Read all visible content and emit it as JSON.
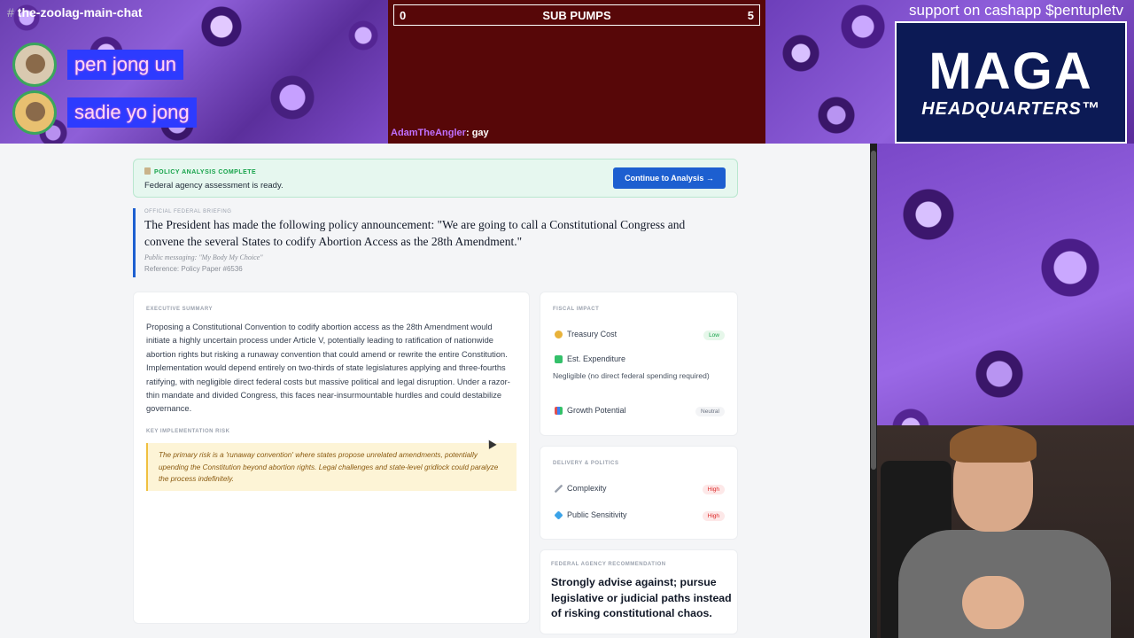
{
  "overlay": {
    "channel_hash": "#",
    "channel_name": "the-zoolag-main-chat",
    "members": [
      "pen jong un",
      "sadie yo jong"
    ],
    "pumps": {
      "left": "0",
      "title": "SUB PUMPS",
      "right": "5"
    },
    "chat": {
      "user": "AdamTheAngler",
      "sep": ": ",
      "message": "gay"
    },
    "support": "support on cashapp $pentupletv",
    "logo": {
      "big": "MAGA",
      "small": "HEADQUARTERS™"
    }
  },
  "banner": {
    "kicker": "POLICY ANALYSIS COMPLETE",
    "message": "Federal agency assessment is ready.",
    "cta": "Continue to Analysis →"
  },
  "briefing": {
    "kicker": "OFFICIAL FEDERAL BRIEFING",
    "title": "The President has made the following policy announcement: \"We are going to call a Constitutional Congress and convene the several States to codify Abortion Access as the 28th Amendment.\"",
    "messaging": "Public messaging: \"My Body My Choice\"",
    "reference": "Reference: Policy Paper #6536"
  },
  "executive": {
    "kicker": "EXECUTIVE SUMMARY",
    "summary": "Proposing a Constitutional Convention to codify abortion access as the 28th Amendment would initiate a highly uncertain process under Article V, potentially leading to ratification of nationwide abortion rights but risking a runaway convention that could amend or rewrite the entire Constitution. Implementation would depend entirely on two-thirds of state legislatures applying and three-fourths ratifying, with negligible direct federal costs but massive political and legal disruption. Under a razor-thin mandate and divided Congress, this faces near-insurmountable hurdles and could destabilize governance.",
    "risk_kicker": "KEY IMPLEMENTATION RISK",
    "risk": "The primary risk is a 'runaway convention' where states propose unrelated amendments, potentially upending the Constitution beyond abortion rights. Legal challenges and state-level gridlock could paralyze the process indefinitely."
  },
  "fiscal": {
    "kicker": "FISCAL IMPACT",
    "treasury_label": "Treasury Cost",
    "treasury_badge": "Low",
    "expenditure_label": "Est. Expenditure",
    "expenditure_value": "Negligible (no direct federal spending required)",
    "growth_label": "Growth Potential",
    "growth_badge": "Neutral"
  },
  "delivery": {
    "kicker": "DELIVERY & POLITICS",
    "complexity_label": "Complexity",
    "complexity_badge": "High",
    "sensitivity_label": "Public Sensitivity",
    "sensitivity_badge": "High"
  },
  "recommendation": {
    "kicker": "FEDERAL AGENCY RECOMMENDATION",
    "text": "Strongly advise against; pursue legislative or judicial paths instead of risking constitutional chaos."
  },
  "colors": {
    "accent": "#1d5fd0",
    "success": "#16a34a",
    "danger": "#dc2626",
    "pumps_bg": "#570708"
  },
  "icons": [
    "treasury-coin-icon",
    "expenditure-chart-icon",
    "growth-chart-icon",
    "complexity-icon",
    "sensitivity-gem-icon",
    "clipboard-icon"
  ]
}
